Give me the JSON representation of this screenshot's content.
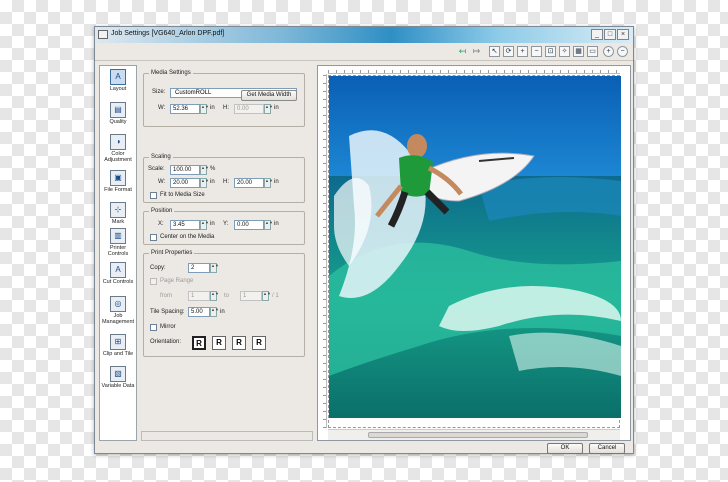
{
  "window": {
    "title": "Job Settings [VG640_Arlon DPF.pdf]",
    "controls": {
      "minimize": "_",
      "maximize": "□",
      "close": "×"
    }
  },
  "toolbar": {
    "icons": [
      "back-arrow-icon",
      "forward-arrow-icon",
      "pointer-icon",
      "rotate-icon",
      "zoom-in-icon",
      "zoom-out-icon",
      "zoom-fit-icon",
      "star-icon",
      "grid-icon",
      "page-icon",
      "add-icon",
      "remove-icon"
    ]
  },
  "sidebar": {
    "items": [
      {
        "label": "Layout",
        "icon": "layout-icon",
        "selected": true
      },
      {
        "label": "Quality",
        "icon": "quality-icon"
      },
      {
        "label": "Color Adjustment",
        "icon": "color-adjustment-icon"
      },
      {
        "label": "File Format",
        "icon": "file-format-icon"
      },
      {
        "label": "Mark",
        "icon": "mark-icon"
      },
      {
        "label": "Printer Controls",
        "icon": "printer-controls-icon"
      },
      {
        "label": "Cut Controls",
        "icon": "cut-controls-icon"
      },
      {
        "label": "Job Management",
        "icon": "job-management-icon"
      },
      {
        "label": "Clip and Tile",
        "icon": "clip-and-tile-icon"
      },
      {
        "label": "Variable Data",
        "icon": "variable-data-icon"
      }
    ]
  },
  "media": {
    "group_title": "Media Settings",
    "size_label": "Size:",
    "size_value": "CustomROLL",
    "w_label": "W:",
    "w_value": "52.36",
    "h_label": "H:",
    "h_value": "0.00",
    "unit": "in",
    "get_width_button": "Get Media Width"
  },
  "scaling": {
    "group_title": "Scaling",
    "scale_label": "Scale:",
    "scale_value": "100.00",
    "scale_unit": "%",
    "w_label": "W:",
    "w_value": "20.00",
    "h_label": "H:",
    "h_value": "20.00",
    "unit": "in",
    "fit_label": "Fit to Media Size"
  },
  "position": {
    "group_title": "Position",
    "x_label": "X:",
    "x_value": "3.45",
    "y_label": "Y:",
    "y_value": "0.00",
    "unit": "in",
    "center_label": "Center on the Media"
  },
  "print": {
    "group_title": "Print Properties",
    "copy_label": "Copy:",
    "copy_value": "2",
    "page_range_label": "Page Range",
    "from_label": "from",
    "from_value": "1",
    "to_label": "to",
    "to_value": "1",
    "of_label": "/ 1",
    "tile_label": "Tile Spacing:",
    "tile_value": "5.00",
    "unit": "in",
    "mirror_label": "Mirror",
    "orientation_label": "Orientation:",
    "orientations": [
      "R",
      "R",
      "R",
      "R"
    ]
  },
  "footer": {
    "ok": "OK",
    "cancel": "Cancel"
  }
}
